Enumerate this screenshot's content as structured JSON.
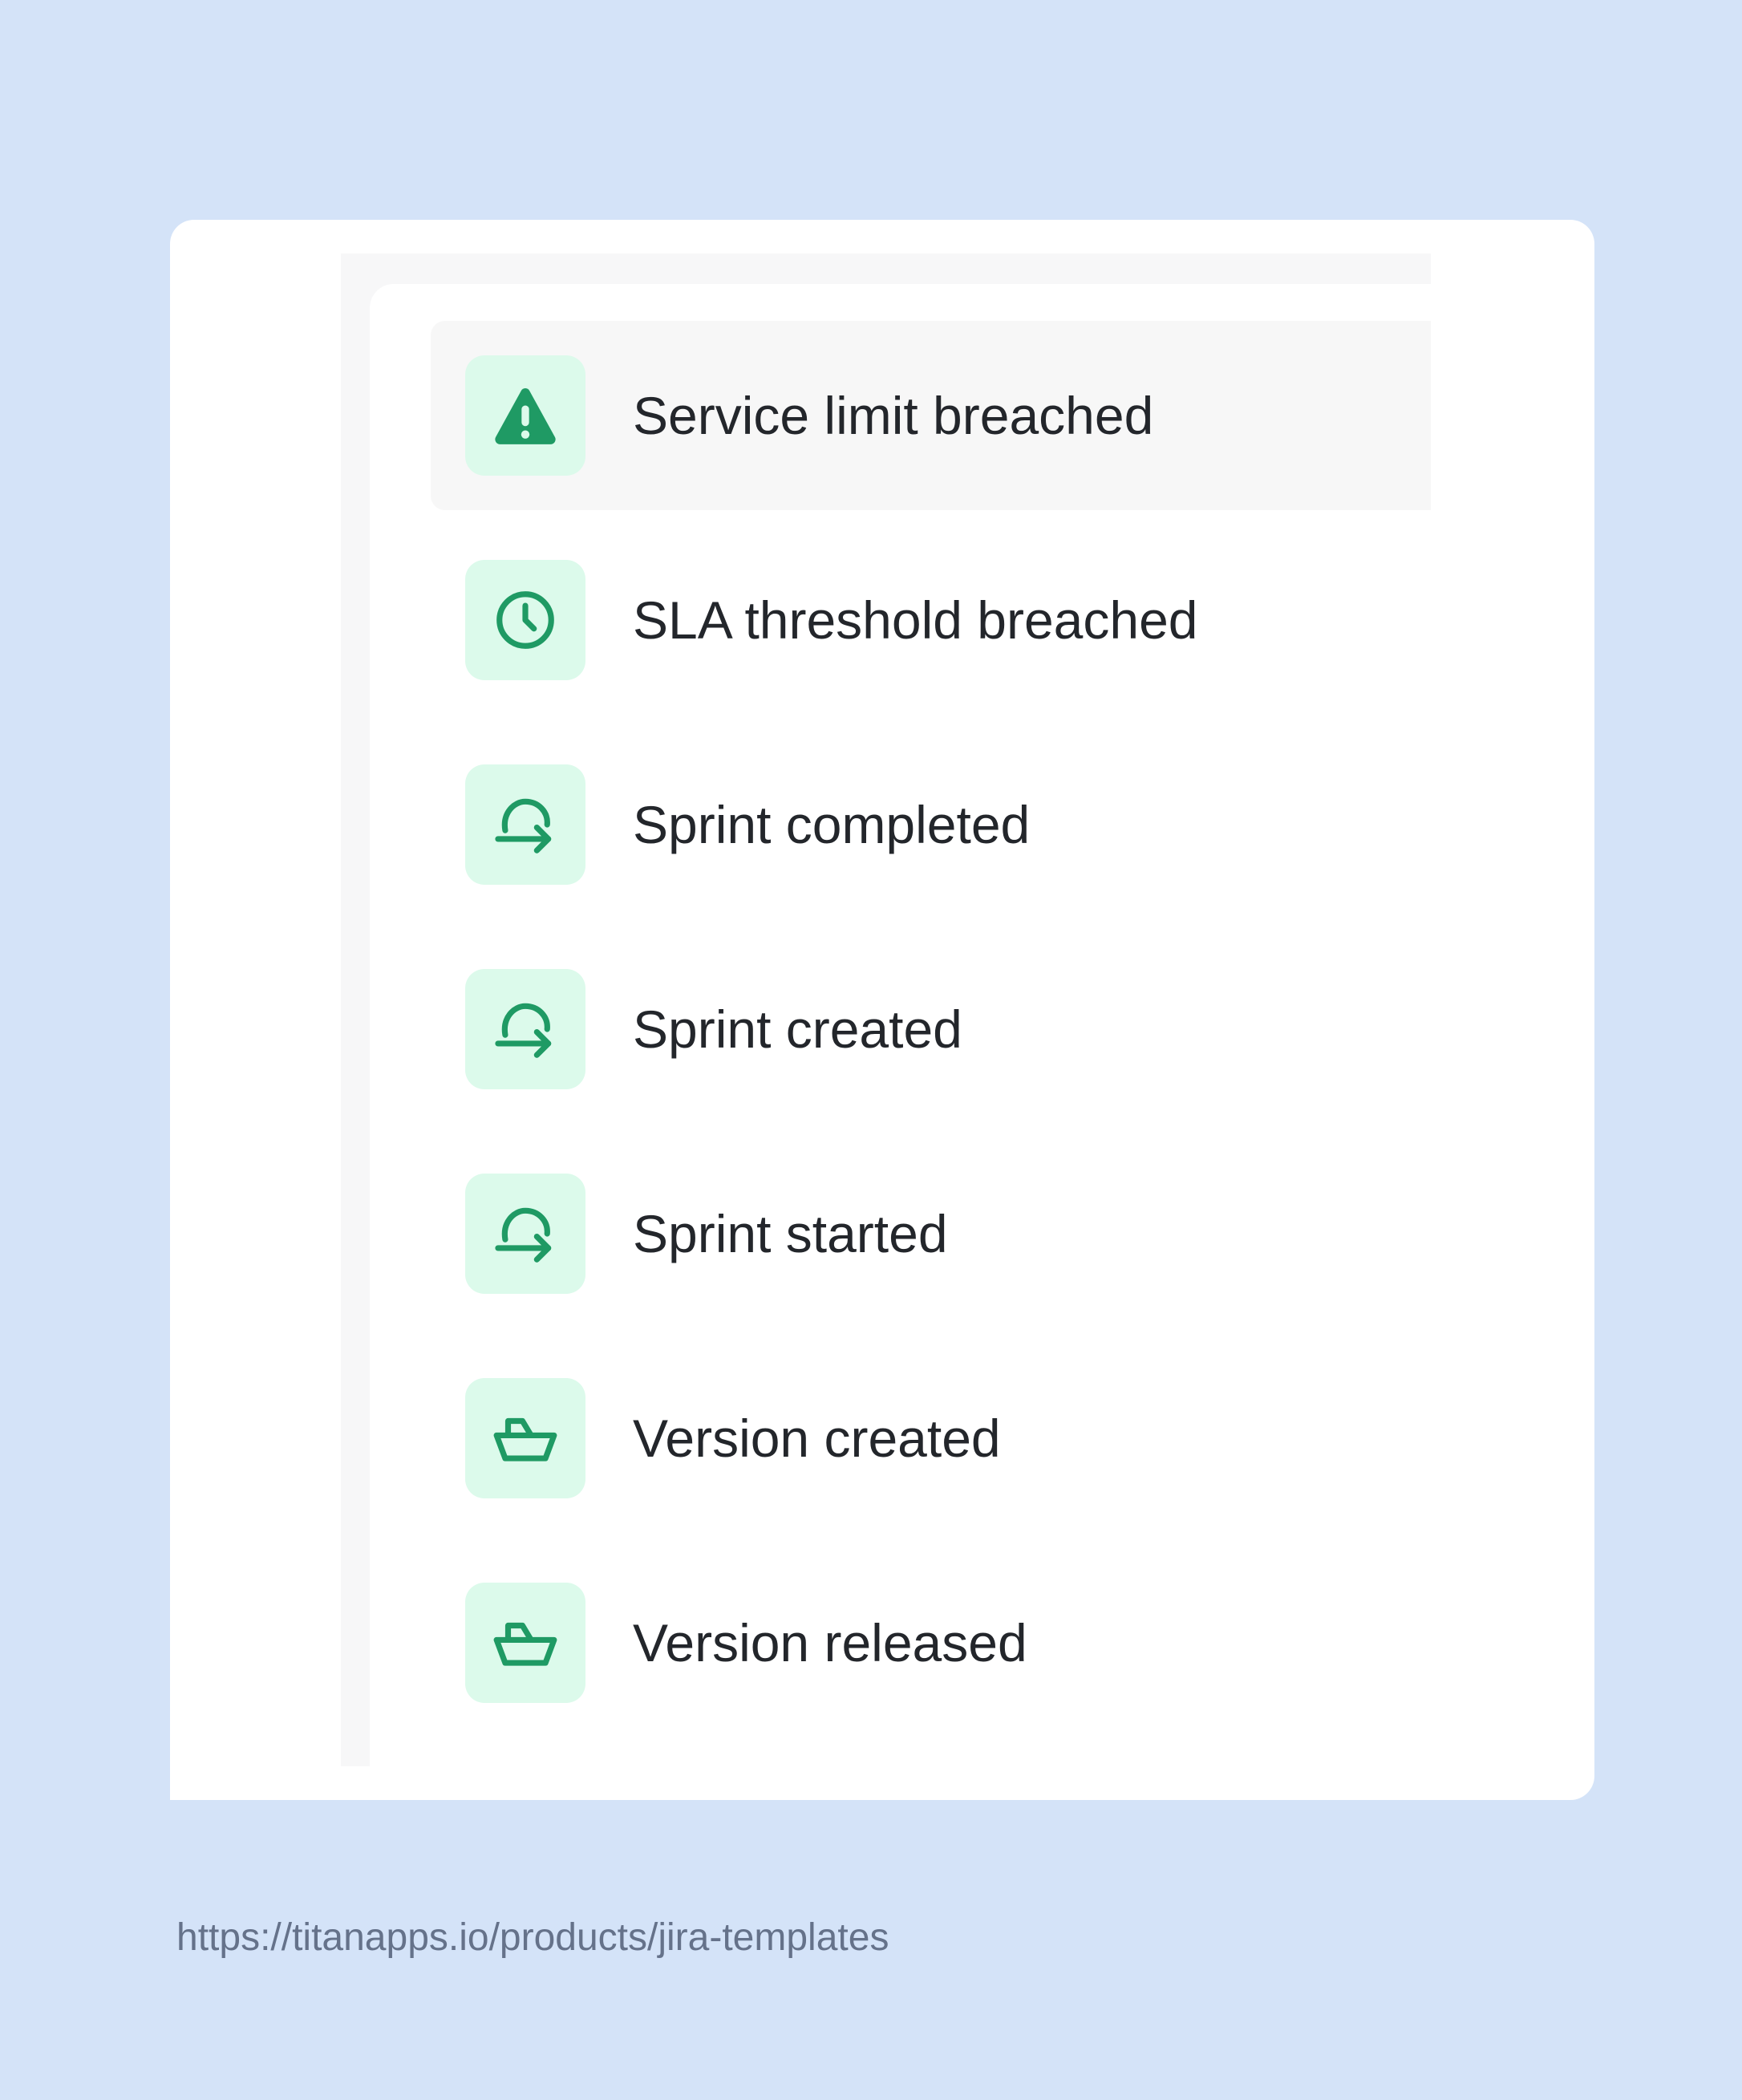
{
  "events": [
    {
      "label": "Service limit breached",
      "icon": "warning-triangle-icon",
      "highlighted": true
    },
    {
      "label": "SLA threshold breached",
      "icon": "clock-icon",
      "highlighted": false
    },
    {
      "label": "Sprint completed",
      "icon": "sprint-arrow-icon",
      "highlighted": false
    },
    {
      "label": "Sprint created",
      "icon": "sprint-arrow-icon",
      "highlighted": false
    },
    {
      "label": "Sprint started",
      "icon": "sprint-arrow-icon",
      "highlighted": false
    },
    {
      "label": "Version created",
      "icon": "ship-icon",
      "highlighted": false
    },
    {
      "label": "Version released",
      "icon": "ship-icon",
      "highlighted": false
    }
  ],
  "footer": {
    "url": "https://titanapps.io/products/jira-templates"
  },
  "colors": {
    "background": "#d4e3f8",
    "icon_bg": "#dcfaeb",
    "icon_fg": "#1f9a64",
    "highlight_row": "#f7f7f7",
    "text": "#23262b",
    "footer_text": "#65728a"
  }
}
